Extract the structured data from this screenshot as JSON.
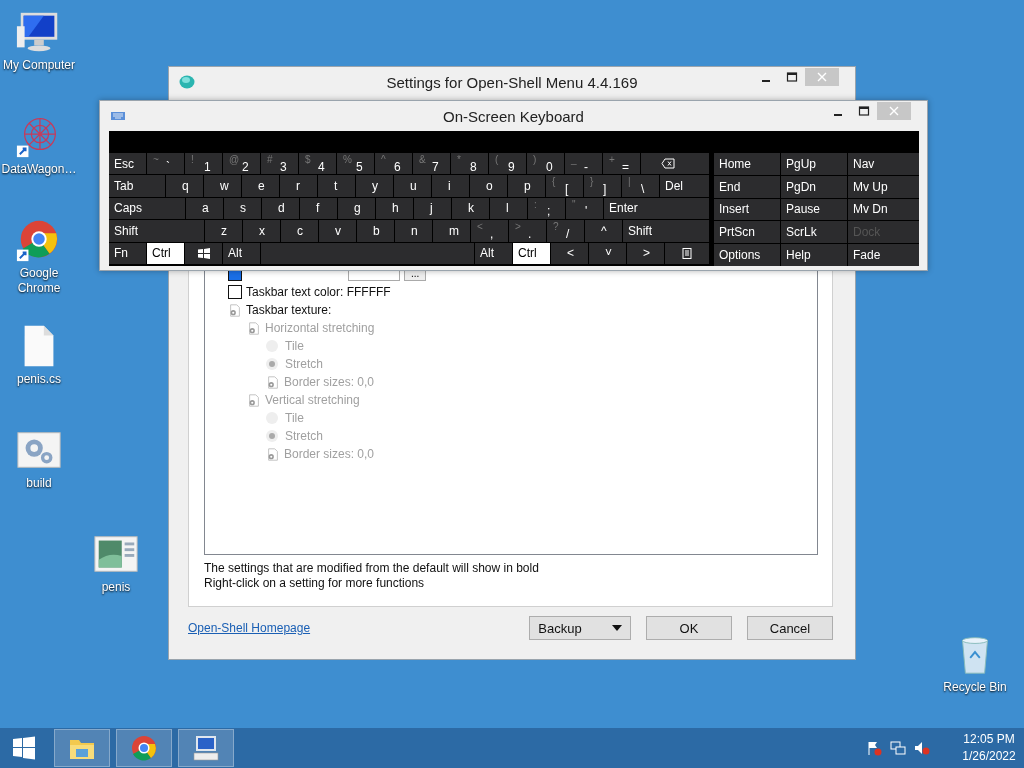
{
  "desktop": {
    "icons": [
      {
        "label": "My Computer",
        "kind": "computer",
        "shortcut": false
      },
      {
        "label": "DataWagon…",
        "kind": "datawagon",
        "shortcut": true
      },
      {
        "label": "Google Chrome",
        "kind": "chrome",
        "shortcut": true
      },
      {
        "label": "penis.cs",
        "kind": "file",
        "shortcut": false
      },
      {
        "label": "build",
        "kind": "build",
        "shortcut": false
      },
      {
        "label": "penis",
        "kind": "image",
        "shortcut": false
      },
      {
        "label": "Recycle Bin",
        "kind": "recycle",
        "shortcut": false
      }
    ]
  },
  "settings_window": {
    "title": "Settings for Open-Shell Menu 4.4.169",
    "tree": [
      {
        "kind": "color_edit",
        "color": "#1a6fe6",
        "browse": "...",
        "disabled": false
      },
      {
        "label": "Taskbar text color: FFFFFF",
        "kind": "color",
        "color": "#ffffff",
        "modified": false,
        "disabled": false
      },
      {
        "label": "Taskbar texture:",
        "kind": "setting",
        "modified": false,
        "disabled": false,
        "children": [
          {
            "label": "Horizontal stretching",
            "kind": "setting",
            "modified": false,
            "disabled": true,
            "children": [
              {
                "label": "Tile",
                "kind": "radio",
                "selected": false,
                "modified": false,
                "disabled": true
              },
              {
                "label": "Stretch",
                "kind": "radio",
                "selected": true,
                "modified": false,
                "disabled": true
              },
              {
                "label": "Border sizes: 0,0",
                "kind": "setting",
                "modified": false,
                "disabled": true
              }
            ]
          },
          {
            "label": "Vertical stretching",
            "kind": "setting",
            "modified": false,
            "disabled": true,
            "children": [
              {
                "label": "Tile",
                "kind": "radio",
                "selected": false,
                "modified": false,
                "disabled": true
              },
              {
                "label": "Stretch",
                "kind": "radio",
                "selected": true,
                "modified": false,
                "disabled": true
              },
              {
                "label": "Border sizes: 0,0",
                "kind": "setting",
                "modified": false,
                "disabled": true
              }
            ]
          }
        ]
      }
    ],
    "notes": [
      "The settings that are modified from the default will show in bold",
      "Right-click on a setting for more functions"
    ],
    "link": "Open-Shell Homepage",
    "buttons": [
      {
        "label": "Backup",
        "kind": "menu"
      },
      {
        "label": "OK",
        "kind": "plain"
      },
      {
        "label": "Cancel",
        "kind": "plain"
      }
    ]
  },
  "keyboard": {
    "title": "On-Screen Keyboard",
    "rows": [
      [
        {
          "kind": "text",
          "label": "Esc",
          "pressed": false
        },
        {
          "kind": "char",
          "shift": "~",
          "label": "`",
          "pressed": false
        },
        {
          "kind": "char",
          "shift": "!",
          "label": "1",
          "pressed": false
        },
        {
          "kind": "char",
          "shift": "@",
          "label": "2",
          "pressed": false
        },
        {
          "kind": "char",
          "shift": "#",
          "label": "3",
          "pressed": false
        },
        {
          "kind": "char",
          "shift": "$",
          "label": "4",
          "pressed": false
        },
        {
          "kind": "char",
          "shift": "%",
          "label": "5",
          "pressed": false
        },
        {
          "kind": "char",
          "shift": "^",
          "label": "6",
          "pressed": false
        },
        {
          "kind": "char",
          "shift": "&",
          "label": "7",
          "pressed": false
        },
        {
          "kind": "char",
          "shift": "*",
          "label": "8",
          "pressed": false
        },
        {
          "kind": "char",
          "shift": "(",
          "label": "9",
          "pressed": false
        },
        {
          "kind": "char",
          "shift": ")",
          "label": "0",
          "pressed": false
        },
        {
          "kind": "char",
          "shift": "_",
          "label": "-",
          "pressed": false
        },
        {
          "kind": "char",
          "shift": "+",
          "label": "=",
          "pressed": false
        },
        {
          "kind": "backspace",
          "pressed": false
        }
      ],
      [
        {
          "kind": "text",
          "label": "Tab",
          "pressed": false
        },
        {
          "kind": "letter",
          "label": "q",
          "pressed": false
        },
        {
          "kind": "letter",
          "label": "w",
          "pressed": false
        },
        {
          "kind": "letter",
          "label": "e",
          "pressed": false
        },
        {
          "kind": "letter",
          "label": "r",
          "pressed": false
        },
        {
          "kind": "letter",
          "label": "t",
          "pressed": false
        },
        {
          "kind": "letter",
          "label": "y",
          "pressed": false
        },
        {
          "kind": "letter",
          "label": "u",
          "pressed": false
        },
        {
          "kind": "letter",
          "label": "i",
          "pressed": false
        },
        {
          "kind": "letter",
          "label": "o",
          "pressed": false
        },
        {
          "kind": "letter",
          "label": "p",
          "pressed": false
        },
        {
          "kind": "char",
          "shift": "{",
          "label": "[",
          "pressed": false
        },
        {
          "kind": "char",
          "shift": "}",
          "label": "]",
          "pressed": false
        },
        {
          "kind": "char",
          "shift": "|",
          "label": "\\",
          "pressed": false
        },
        {
          "kind": "text",
          "label": "Del",
          "pressed": false
        }
      ],
      [
        {
          "kind": "text",
          "label": "Caps",
          "pressed": false
        },
        {
          "kind": "letter",
          "label": "a",
          "pressed": false
        },
        {
          "kind": "letter",
          "label": "s",
          "pressed": false
        },
        {
          "kind": "letter",
          "label": "d",
          "pressed": false
        },
        {
          "kind": "letter",
          "label": "f",
          "pressed": false
        },
        {
          "kind": "letter",
          "label": "g",
          "pressed": false
        },
        {
          "kind": "letter",
          "label": "h",
          "pressed": false
        },
        {
          "kind": "letter",
          "label": "j",
          "pressed": false
        },
        {
          "kind": "letter",
          "label": "k",
          "pressed": false
        },
        {
          "kind": "letter",
          "label": "l",
          "pressed": false
        },
        {
          "kind": "char",
          "shift": ":",
          "label": ";",
          "pressed": false
        },
        {
          "kind": "char",
          "shift": "\"",
          "label": "'",
          "pressed": false
        },
        {
          "kind": "text",
          "label": "Enter",
          "pressed": false
        }
      ],
      [
        {
          "kind": "text",
          "label": "Shift",
          "pressed": false
        },
        {
          "kind": "letter",
          "label": "z",
          "pressed": false
        },
        {
          "kind": "letter",
          "label": "x",
          "pressed": false
        },
        {
          "kind": "letter",
          "label": "c",
          "pressed": false
        },
        {
          "kind": "letter",
          "label": "v",
          "pressed": false
        },
        {
          "kind": "letter",
          "label": "b",
          "pressed": false
        },
        {
          "kind": "letter",
          "label": "n",
          "pressed": false
        },
        {
          "kind": "letter",
          "label": "m",
          "pressed": false
        },
        {
          "kind": "char",
          "shift": "<",
          "label": ",",
          "pressed": false
        },
        {
          "kind": "char",
          "shift": ">",
          "label": ".",
          "pressed": false
        },
        {
          "kind": "char",
          "shift": "?",
          "label": "/",
          "pressed": false
        },
        {
          "kind": "letter",
          "label": "^",
          "pressed": false
        },
        {
          "kind": "text",
          "label": "Shift",
          "pressed": false
        }
      ],
      [
        {
          "kind": "text",
          "label": "Fn",
          "pressed": false
        },
        {
          "kind": "text",
          "label": "Ctrl",
          "pressed": true
        },
        {
          "kind": "windows",
          "pressed": false
        },
        {
          "kind": "text",
          "label": "Alt",
          "pressed": false
        },
        {
          "kind": "space",
          "pressed": false
        },
        {
          "kind": "text",
          "label": "Alt",
          "pressed": false
        },
        {
          "kind": "text",
          "label": "Ctrl",
          "pressed": true
        },
        {
          "kind": "letter",
          "label": "<",
          "pressed": false
        },
        {
          "kind": "letter",
          "label": "˅",
          "pressed": false
        },
        {
          "kind": "letter",
          "label": ">",
          "pressed": false
        },
        {
          "kind": "menu",
          "pressed": false
        }
      ]
    ],
    "nav": [
      [
        {
          "label": "Home",
          "disabled": false
        },
        {
          "label": "PgUp",
          "disabled": false
        },
        {
          "label": "Nav",
          "disabled": false
        }
      ],
      [
        {
          "label": "End",
          "disabled": false
        },
        {
          "label": "PgDn",
          "disabled": false
        },
        {
          "label": "Mv Up",
          "disabled": false
        }
      ],
      [
        {
          "label": "Insert",
          "disabled": false
        },
        {
          "label": "Pause",
          "disabled": false
        },
        {
          "label": "Mv Dn",
          "disabled": false
        }
      ],
      [
        {
          "label": "PrtScn",
          "disabled": false
        },
        {
          "label": "ScrLk",
          "disabled": false
        },
        {
          "label": "Dock",
          "disabled": true
        }
      ],
      [
        {
          "label": "Options",
          "disabled": false
        },
        {
          "label": "Help",
          "disabled": false
        },
        {
          "label": "Fade",
          "disabled": false
        }
      ]
    ]
  },
  "taskbar": {
    "apps": [
      {
        "kind": "explorer"
      },
      {
        "kind": "chrome"
      },
      {
        "kind": "keyboard"
      }
    ],
    "time": "12:05 PM",
    "date": "1/26/2022"
  }
}
